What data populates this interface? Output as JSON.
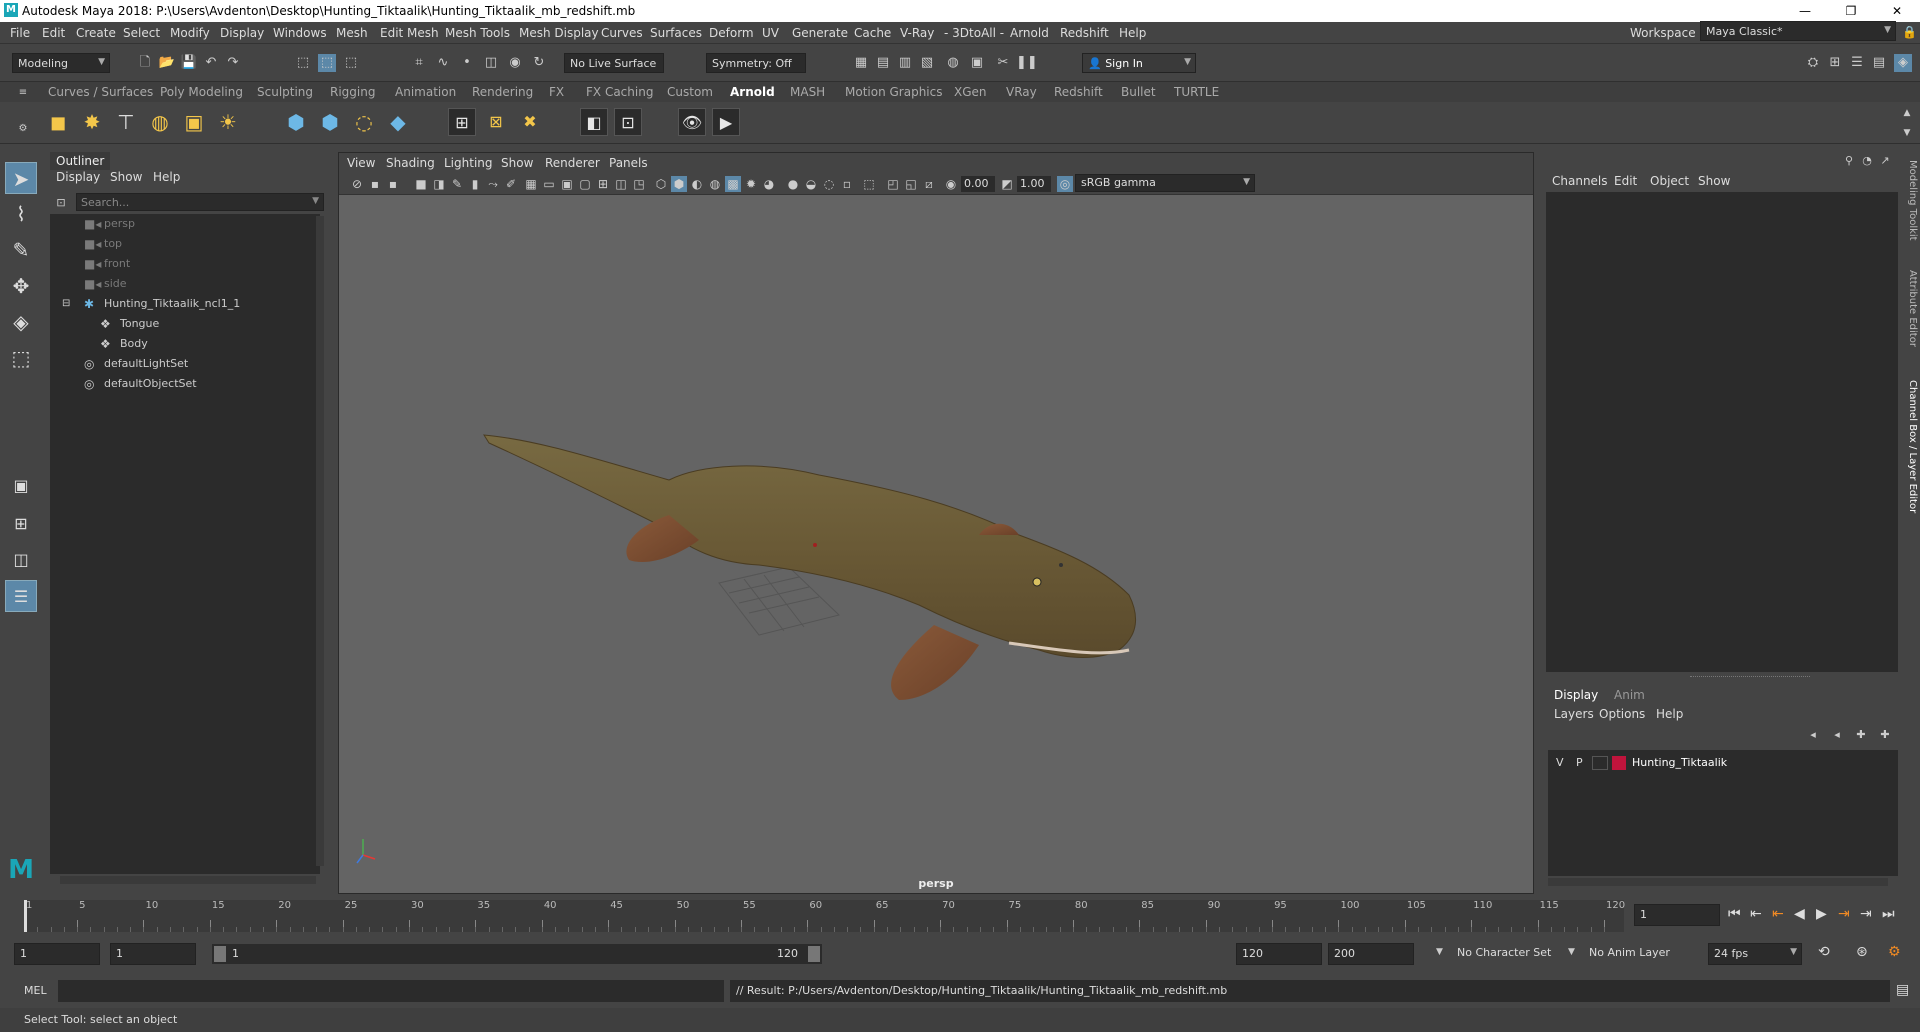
{
  "window": {
    "title": "Autodesk Maya 2018: P:\\Users\\Avdenton\\Desktop\\Hunting_Tiktaalik\\Hunting_Tiktaalik_mb_redshift.mb"
  },
  "menubar": [
    "File",
    "Edit",
    "Create",
    "Select",
    "Modify",
    "Display",
    "Windows",
    "Mesh",
    "Edit Mesh",
    "Mesh Tools",
    "Mesh Display",
    "Curves",
    "Surfaces",
    "Deform",
    "UV",
    "Generate",
    "Cache",
    "V-Ray",
    "- 3DtoAll -",
    "Arnold",
    "Redshift",
    "Help"
  ],
  "workspace": {
    "label": "Workspace :",
    "value": "Maya Classic*"
  },
  "statusline": {
    "mode": "Modeling",
    "live_surface": "No Live Surface",
    "symmetry": "Symmetry: Off",
    "sign_in": "Sign In"
  },
  "shelf_tabs": [
    "Curves / Surfaces",
    "Poly Modeling",
    "Sculpting",
    "Rigging",
    "Animation",
    "Rendering",
    "FX",
    "FX Caching",
    "Custom",
    "Arnold",
    "MASH",
    "Motion Graphics",
    "XGen",
    "VRay",
    "Redshift",
    "Bullet",
    "TURTLE"
  ],
  "shelf_active": "Arnold",
  "outliner": {
    "title": "Outliner",
    "menu": [
      "Display",
      "Show",
      "Help"
    ],
    "search_placeholder": "Search...",
    "items": [
      {
        "label": "persp",
        "icon": "camera-icon"
      },
      {
        "label": "top",
        "icon": "camera-icon"
      },
      {
        "label": "front",
        "icon": "camera-icon"
      },
      {
        "label": "side",
        "icon": "camera-icon"
      },
      {
        "label": "Hunting_Tiktaalik_ncl1_1",
        "icon": "group-icon"
      },
      {
        "label": "Tongue",
        "icon": "mesh-icon"
      },
      {
        "label": "Body",
        "icon": "mesh-icon"
      },
      {
        "label": "defaultLightSet",
        "icon": "set-icon"
      },
      {
        "label": "defaultObjectSet",
        "icon": "set-icon"
      }
    ]
  },
  "viewport": {
    "menu": [
      "View",
      "Shading",
      "Lighting",
      "Show",
      "Renderer",
      "Panels"
    ],
    "exposure": "0.00",
    "gamma": "1.00",
    "color_space": "sRGB gamma",
    "camera_label": "persp"
  },
  "channelbox": {
    "menu": [
      "Channels",
      "Edit",
      "Object",
      "Show"
    ]
  },
  "layers": {
    "tabs": [
      "Display",
      "Anim"
    ],
    "menu": [
      "Layers",
      "Options",
      "Help"
    ],
    "rows": [
      {
        "v": "V",
        "p": "P",
        "name": "Hunting_Tiktaalik",
        "color": "#c0143c"
      }
    ]
  },
  "side_tabs": [
    "Modeling Toolkit",
    "Attribute Editor",
    "Channel Box / Layer Editor"
  ],
  "timeline": {
    "ticks": [
      "1",
      "5",
      "10",
      "15",
      "20",
      "25",
      "30",
      "35",
      "40",
      "45",
      "50",
      "55",
      "60",
      "65",
      "70",
      "75",
      "80",
      "85",
      "90",
      "95",
      "100",
      "105",
      "110",
      "115",
      "120"
    ],
    "current_frame": "1"
  },
  "range": {
    "start": "1",
    "anim_start": "1",
    "range_start": "1",
    "range_end": "120",
    "anim_end_a": "120",
    "anim_end_b": "200",
    "character_set": "No Character Set",
    "anim_layer": "No Anim Layer",
    "fps": "24 fps"
  },
  "cmd": {
    "label": "MEL",
    "result": "// Result: P:/Users/Avdenton/Desktop/Hunting_Tiktaalik/Hunting_Tiktaalik_mb_redshift.mb"
  },
  "helpline": "Select Tool: select an object",
  "colors": {
    "accent": "#5c88a8",
    "shelf_yellow": "#f3c64a",
    "shelf_blue": "#6db8e6",
    "layer_red": "#c0143c"
  }
}
